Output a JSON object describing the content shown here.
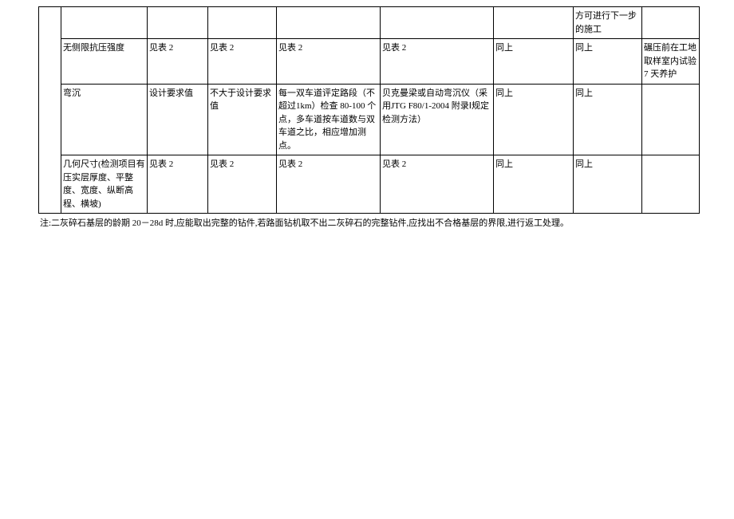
{
  "table": {
    "rows": [
      {
        "c0": "",
        "c1": "",
        "c2": "",
        "c3": "",
        "c4": "",
        "c5": "",
        "c6": "",
        "c7": "方可进行下一步的施工",
        "c8": ""
      },
      {
        "c1": "无侧限抗压强度",
        "c2": "见表 2",
        "c3": "见表 2",
        "c4": "见表 2",
        "c5": "见表 2",
        "c6": "同上",
        "c7": "同上",
        "c8": "碾压前在工地取样室内试验 7 天养护"
      },
      {
        "c1": "弯沉",
        "c2": "设计要求值",
        "c3": "不大于设计要求值",
        "c4": "每一双车道评定路段（不超过1km）检查 80-100 个点，多车道按车道数与双车道之比，相应增加测点。",
        "c5": "贝克曼梁或自动弯沉仪（采用JTG F80/1-2004 附录Ⅰ规定检测方法）",
        "c6": "同上",
        "c7": "同上",
        "c8": ""
      },
      {
        "c1": "几何尺寸(检测项目有压实层厚度、平整度、宽度、纵断高程、横坡)",
        "c2": "见表 2",
        "c3": "见表 2",
        "c4": "见表 2",
        "c5": "见表 2",
        "c6": "同上",
        "c7": "同上",
        "c8": ""
      }
    ]
  },
  "note": "注:二灰碎石基层的龄期 20－28d 时,应能取出完整的钻件,若路面钻机取不出二灰碎石的完整钻件,应找出不合格基层的界限,进行返工处理。"
}
